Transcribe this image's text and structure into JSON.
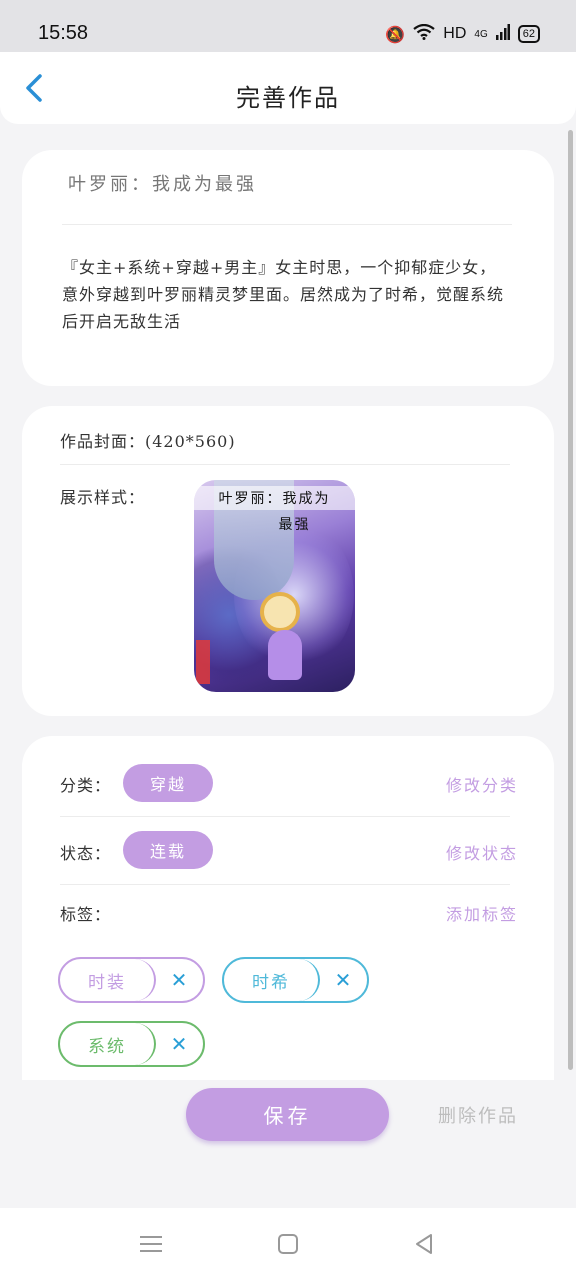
{
  "status_bar": {
    "time": "15:58",
    "network": "HD",
    "signal": "4G",
    "battery": "62",
    "icons": [
      "mute-icon",
      "wifi-icon",
      "signal-icon",
      "battery-icon"
    ]
  },
  "nav": {
    "title": "完善作品",
    "back_icon": "chevron-left-icon"
  },
  "work": {
    "title": "叶罗丽：我成为最强",
    "description": "『女主+系统+穿越+男主』女主时思，一个抑郁症少女，意外穿越到叶罗丽精灵梦里面。居然成为了时希，觉醒系统后开启无敌生活"
  },
  "cover": {
    "label": "作品封面：(420*560)",
    "display_label": "展示样式：",
    "caption_line1": "叶罗丽：我成为",
    "caption_line2": "最强"
  },
  "meta": {
    "category_label": "分类：",
    "category_value": "穿越",
    "category_action": "修改分类",
    "status_label": "状态：",
    "status_value": "连载",
    "status_action": "修改状态",
    "tags_label": "标签：",
    "tags_action": "添加标签"
  },
  "tags": [
    {
      "text": "时装",
      "color": "#c39de2"
    },
    {
      "text": "时希",
      "color": "#4fb9d9"
    },
    {
      "text": "系统",
      "color": "#6cbb6c"
    }
  ],
  "actions": {
    "save": "保存",
    "delete": "删除作品"
  },
  "colors": {
    "accent": "#c39de2",
    "back_arrow": "#2a8fd6",
    "tag_close": "#2a9fd6",
    "delete_text": "#bdbdbd"
  }
}
